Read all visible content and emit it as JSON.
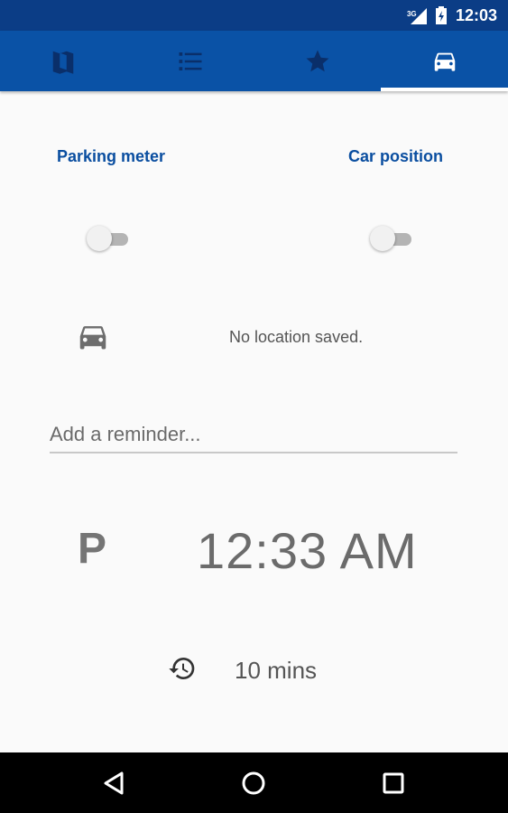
{
  "status_bar": {
    "network": "3G",
    "time": "12:03"
  },
  "tabs": [
    {
      "icon": "map-icon"
    },
    {
      "icon": "list-icon"
    },
    {
      "icon": "star-icon"
    },
    {
      "icon": "car-icon",
      "active": true
    }
  ],
  "parking": {
    "meter_label": "Parking meter",
    "car_position_label": "Car position",
    "meter_enabled": false,
    "car_position_enabled": false,
    "location_text": "No location saved.",
    "reminder_placeholder": "Add a reminder...",
    "reminder_value": "",
    "expiry_time": "12:33 AM",
    "p_label": "P",
    "duration": "10 mins"
  },
  "colors": {
    "status_bar": "#0b3d86",
    "tab_bar": "#0a52a6",
    "accent_text": "#0a4ea0",
    "background": "#fafafa"
  }
}
